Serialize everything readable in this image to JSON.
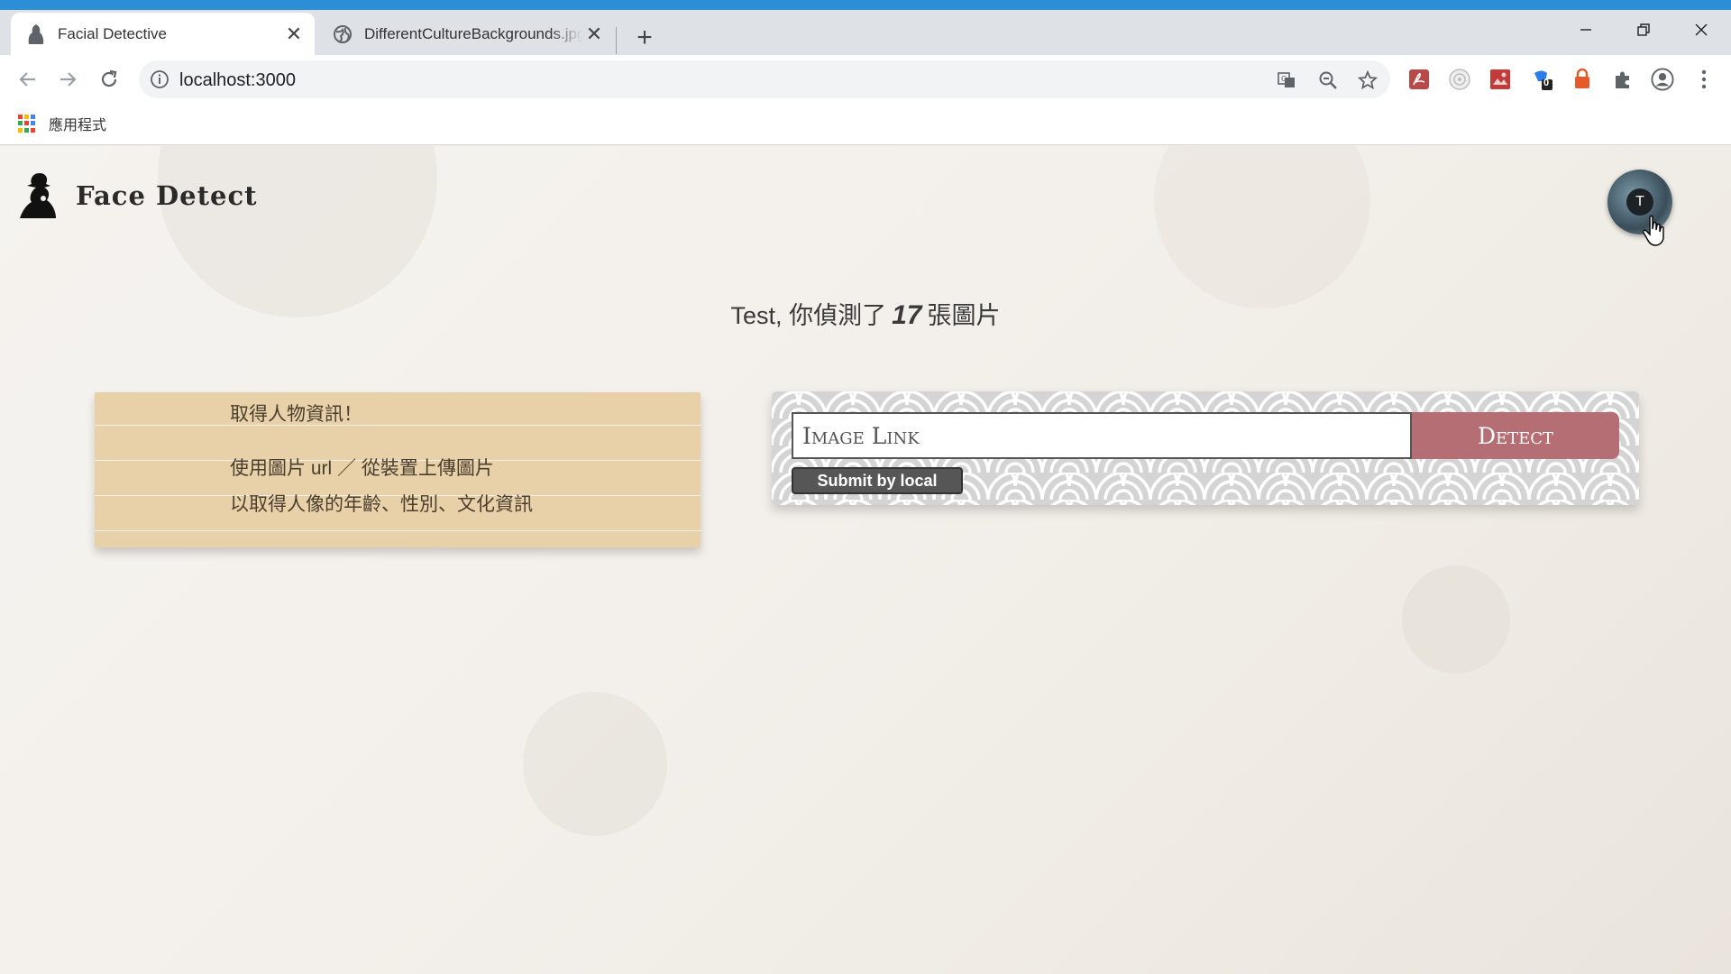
{
  "browser": {
    "tabs": [
      {
        "title": "Facial Detective",
        "active": true
      },
      {
        "title": "DifferentCultureBackgrounds.jpg",
        "active": false
      }
    ],
    "close_glyph": "✕",
    "new_tab_glyph": "+",
    "address": "localhost:3000",
    "bookmarks": [
      {
        "label": "應用程式",
        "icon": "apps-grid-icon"
      }
    ],
    "extension_badge": "0",
    "window_controls": [
      "minimize",
      "restore",
      "close"
    ]
  },
  "page": {
    "logo_text": "Face Detect",
    "avatar_letter": "T",
    "greeting": {
      "name": "Test,",
      "prefix": "你偵測了",
      "count": "17",
      "suffix": "張圖片"
    },
    "info_card": {
      "heading": "取得人物資訊！",
      "line1": "使用圖片 url ／ 從裝置上傳圖片",
      "line2": "以取得人像的年齡、性別、文化資訊"
    },
    "form": {
      "input_placeholder": "Image Link",
      "input_value": "",
      "detect_label": "Detect",
      "local_label": "Submit by local"
    }
  },
  "colors": {
    "accent_bar": "#2b8ed6",
    "detect_button": "#b56e73",
    "note_background": "#e8d1a9",
    "local_button": "#565656"
  }
}
